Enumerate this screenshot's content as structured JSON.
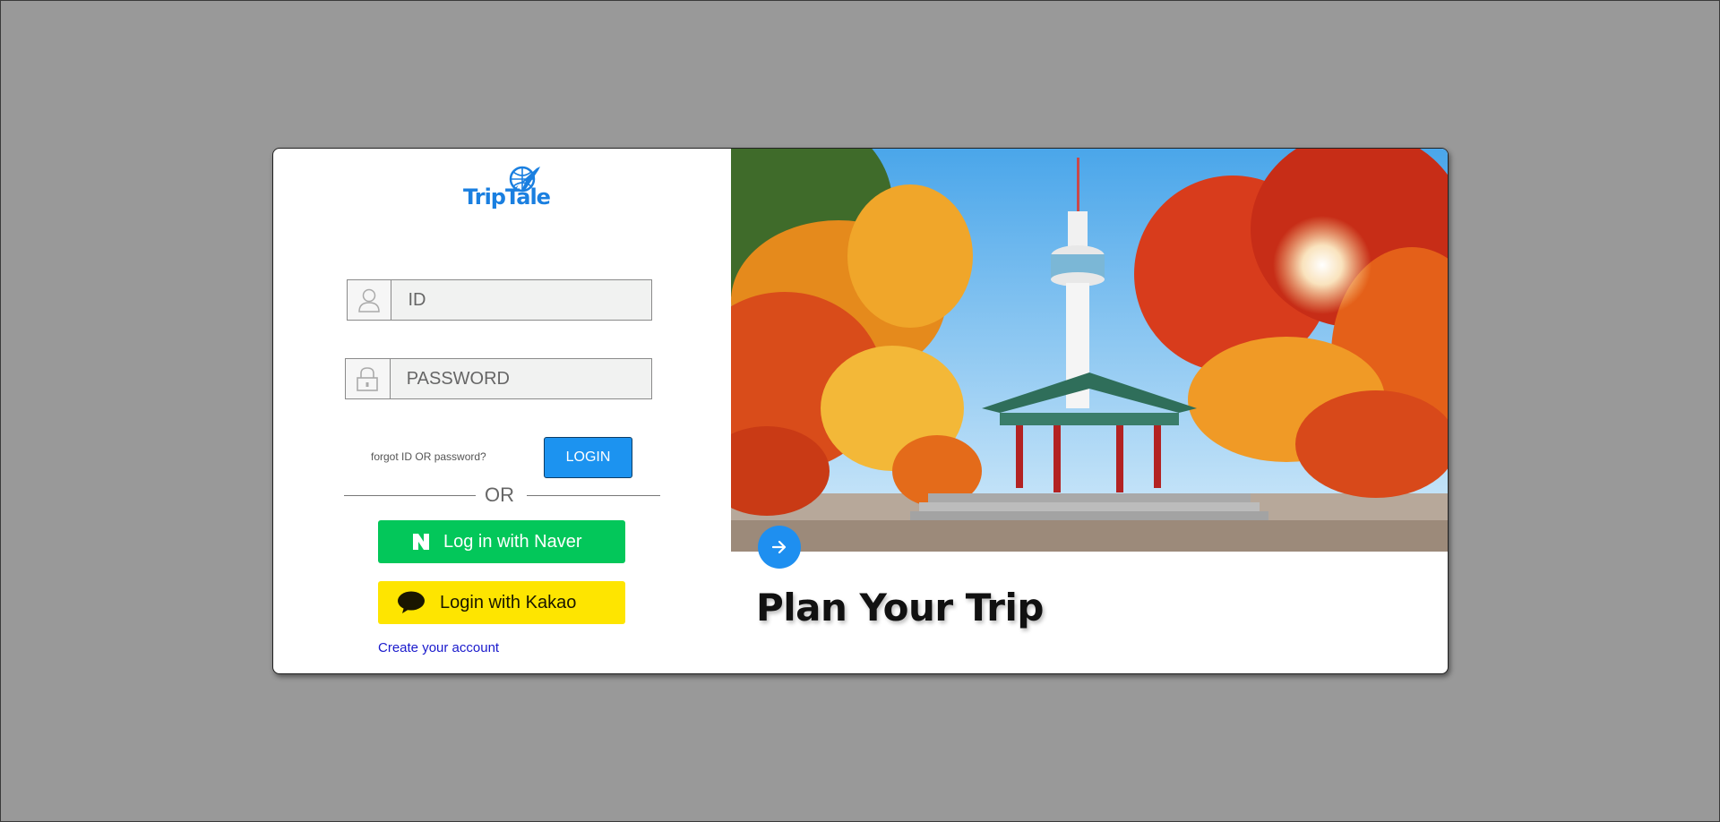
{
  "brand": {
    "name": "TripTale",
    "color": "#1a7fe0"
  },
  "login_form": {
    "id_placeholder": "ID",
    "password_placeholder": "PASSWORD",
    "forgot_link": "forgot ID OR password?",
    "login_button": "LOGIN",
    "or_divider": "OR",
    "naver_button": "Log in with Naver",
    "kakao_button": "Login with Kakao",
    "create_account_link": "Create your account"
  },
  "icons": {
    "id_field": "user-icon",
    "password_field": "lock-icon",
    "naver": "naver-n-icon",
    "kakao": "kakao-speech-bubble-icon",
    "next": "arrow-right-icon"
  },
  "hero": {
    "headline": "Plan Your Trip",
    "image_alt": "N Seoul Tower with autumn foliage and pavilion"
  },
  "colors": {
    "login_button": "#1c93f0",
    "naver": "#03c75a",
    "kakao": "#fee500",
    "next_button": "#1e8ff0",
    "background": "#999999"
  }
}
